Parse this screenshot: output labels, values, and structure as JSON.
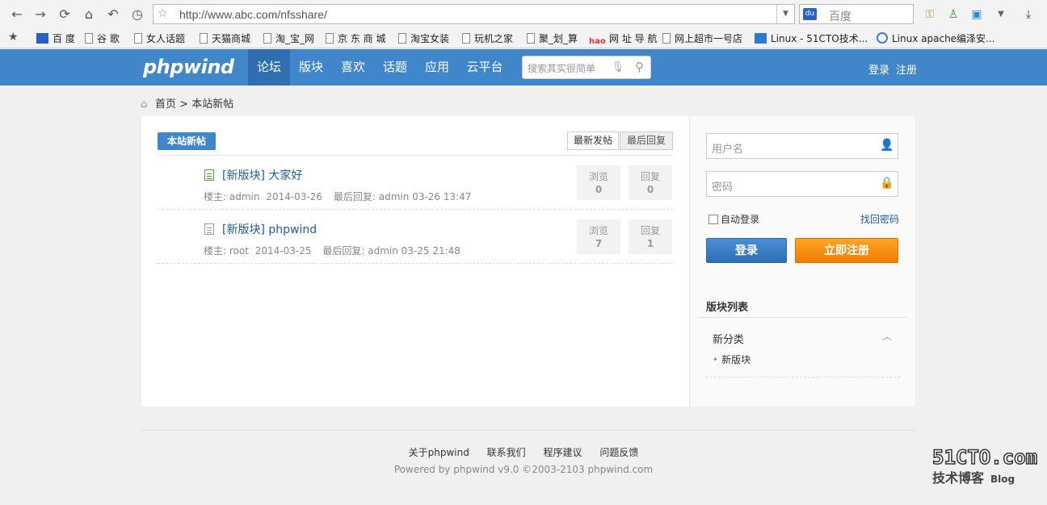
{
  "browser": {
    "url": "http://www.abc.com/nfsshare/",
    "search_engine": "百度"
  },
  "bookmarks": [
    {
      "label": "百 度",
      "icon": "baidu-icon"
    },
    {
      "label": "谷 歌",
      "icon": "page-icon"
    },
    {
      "label": "女人话题",
      "icon": "page-icon"
    },
    {
      "label": "天猫商城",
      "icon": "page-icon"
    },
    {
      "label": "淘_宝_网",
      "icon": "page-icon"
    },
    {
      "label": "京 东 商 城",
      "icon": "page-icon"
    },
    {
      "label": "淘宝女装",
      "icon": "page-icon"
    },
    {
      "label": "玩机之家",
      "icon": "page-icon"
    },
    {
      "label": "聚_划_算",
      "icon": "page-icon"
    },
    {
      "label": "网 址 导 航",
      "icon": "hao-icon"
    },
    {
      "label": "网上超市一号店",
      "icon": "page-icon"
    },
    {
      "label": "Linux - 51CTO技术...",
      "icon": "cto-icon"
    },
    {
      "label": "Linux apache编泽安...",
      "icon": "apache-icon"
    }
  ],
  "site": {
    "logo": "phpwind",
    "nav": [
      "论坛",
      "版块",
      "喜欢",
      "话题",
      "应用",
      "云平台"
    ],
    "search_placeholder": "搜索其实很简单",
    "login": "登录",
    "register": "注册"
  },
  "breadcrumb": {
    "home": "首页",
    "sep": ">",
    "current": "本站新帖"
  },
  "main": {
    "tag": "本站新帖",
    "sort_newest": "最新发帖",
    "sort_last_reply": "最后回复",
    "posts": [
      {
        "title": "[新版块] 大家好",
        "author_label": "楼主:",
        "author": "admin",
        "date": "2014-03-26",
        "last_reply_label": "最后回复:",
        "last_reply": "admin 03-26 13:47",
        "views_label": "浏览",
        "views": "0",
        "replies_label": "回复",
        "replies": "0",
        "icon_color": "#4aa33a"
      },
      {
        "title": "[新版块] phpwind",
        "author_label": "楼主:",
        "author": "root",
        "date": "2014-03-25",
        "last_reply_label": "最后回复:",
        "last_reply": "admin 03-25 21:48",
        "views_label": "浏览",
        "views": "7",
        "replies_label": "回复",
        "replies": "1",
        "icon_color": "#999999"
      }
    ]
  },
  "sidebar": {
    "username_placeholder": "用户名",
    "password_placeholder": "密码",
    "remember": "自动登录",
    "forgot": "找回密码",
    "login_button": "登录",
    "register_button": "立即注册",
    "section_title": "版块列表",
    "category": "新分类",
    "forum": "新版块"
  },
  "footer": {
    "links": [
      "关于phpwind",
      "联系我们",
      "程序建议",
      "问题反馈"
    ],
    "powered": "Powered by phpwind v9.0 ©2003-2103 phpwind.com"
  },
  "watermark": {
    "line1": "51CTO.com",
    "line2": "技术博客",
    "line3": "Blog"
  },
  "colors": {
    "header": "#3f86cb",
    "active_nav": "#2f6fb1",
    "link": "#1f5c9a",
    "register_button": "#f07c00"
  }
}
